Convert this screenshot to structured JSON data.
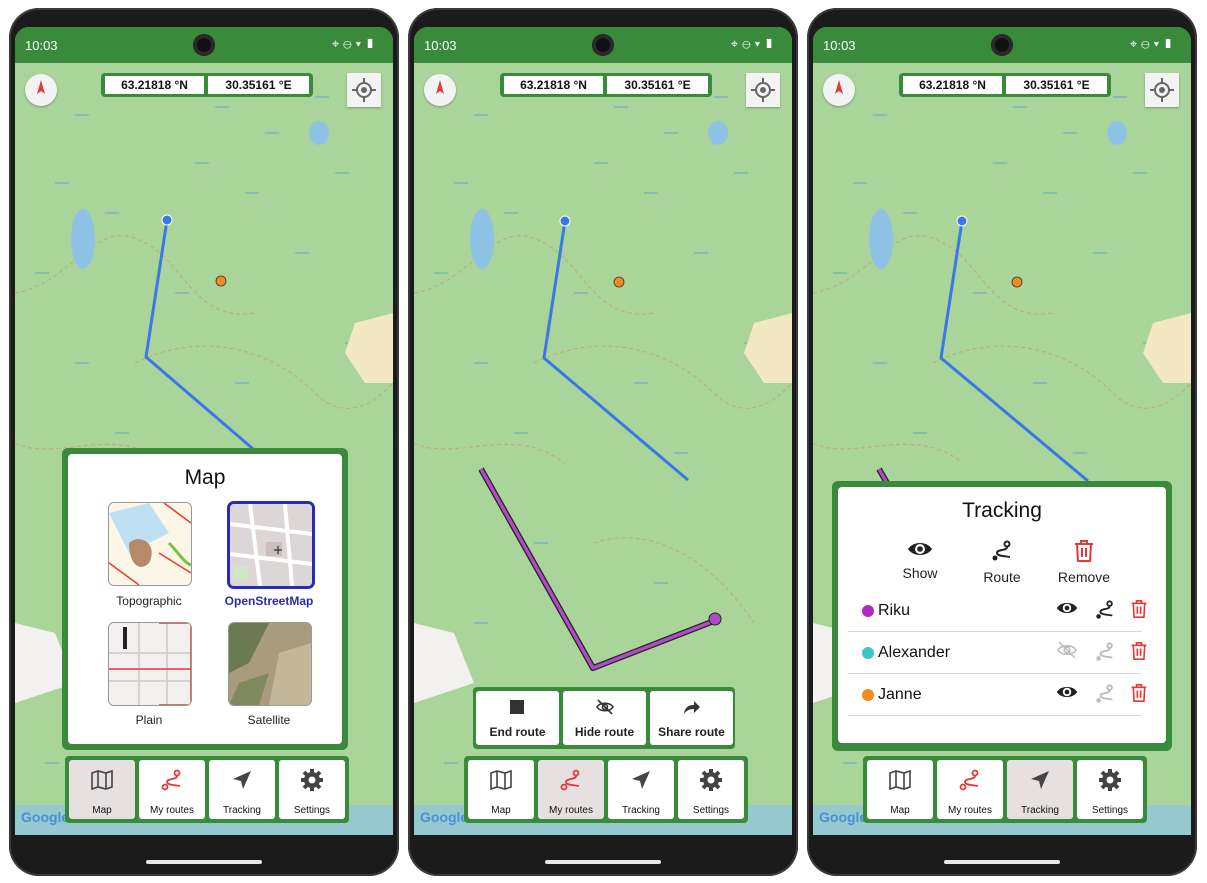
{
  "colors": {
    "brand_green": "#3a8a3c",
    "map_green": "#a9d59a",
    "route_blue": "#3b78e7",
    "route_purple": "#b14ac5",
    "delete_red": "#e53935",
    "selected_blue": "#2a2ab8"
  },
  "phones": [
    {
      "status": {
        "time": "10:03"
      },
      "coords": {
        "lat": "63.21818 °N",
        "lon": "30.35161 °E"
      },
      "attribution": "Google",
      "nav": [
        {
          "label": "Map",
          "icon": "map-icon",
          "active": true
        },
        {
          "label": "My routes",
          "icon": "routes-icon",
          "active": false
        },
        {
          "label": "Tracking",
          "icon": "navigation-arrow-icon",
          "active": false
        },
        {
          "label": "Settings",
          "icon": "gear-icon",
          "active": false
        }
      ],
      "map_panel": {
        "title": "Map",
        "options": [
          {
            "label": "Topographic",
            "selected": false
          },
          {
            "label": "OpenStreetMap",
            "selected": true
          },
          {
            "label": "Plain",
            "selected": false
          },
          {
            "label": "Satellite",
            "selected": false
          }
        ]
      }
    },
    {
      "status": {
        "time": "10:03"
      },
      "coords": {
        "lat": "63.21818 °N",
        "lon": "30.35161 °E"
      },
      "attribution": "Google",
      "nav": [
        {
          "label": "Map",
          "icon": "map-icon",
          "active": false
        },
        {
          "label": "My routes",
          "icon": "routes-icon",
          "active": true
        },
        {
          "label": "Tracking",
          "icon": "navigation-arrow-icon",
          "active": false
        },
        {
          "label": "Settings",
          "icon": "gear-icon",
          "active": false
        }
      ],
      "route_actions": [
        {
          "label": "End route",
          "icon": "stop-icon"
        },
        {
          "label": "Hide route",
          "icon": "eye-off-icon"
        },
        {
          "label": "Share route",
          "icon": "share-icon"
        }
      ]
    },
    {
      "status": {
        "time": "10:03"
      },
      "coords": {
        "lat": "63.21818 °N",
        "lon": "30.35161 °E"
      },
      "attribution": "Google",
      "nav": [
        {
          "label": "Map",
          "icon": "map-icon",
          "active": false
        },
        {
          "label": "My routes",
          "icon": "routes-icon",
          "active": false
        },
        {
          "label": "Tracking",
          "icon": "navigation-arrow-icon",
          "active": true
        },
        {
          "label": "Settings",
          "icon": "gear-icon",
          "active": false
        }
      ],
      "tracking_panel": {
        "title": "Tracking",
        "headers": [
          {
            "label": "Show",
            "icon": "eye-icon"
          },
          {
            "label": "Route",
            "icon": "route-icon"
          },
          {
            "label": "Remove",
            "icon": "trash-icon"
          }
        ],
        "users": [
          {
            "name": "Riku",
            "color": "#b02ac0",
            "visible": true,
            "route_on": true
          },
          {
            "name": "Alexander",
            "color": "#3cc6c6",
            "visible": false,
            "route_on": false
          },
          {
            "name": "Janne",
            "color": "#f58a1f",
            "visible": true,
            "route_on": false
          }
        ]
      }
    }
  ]
}
